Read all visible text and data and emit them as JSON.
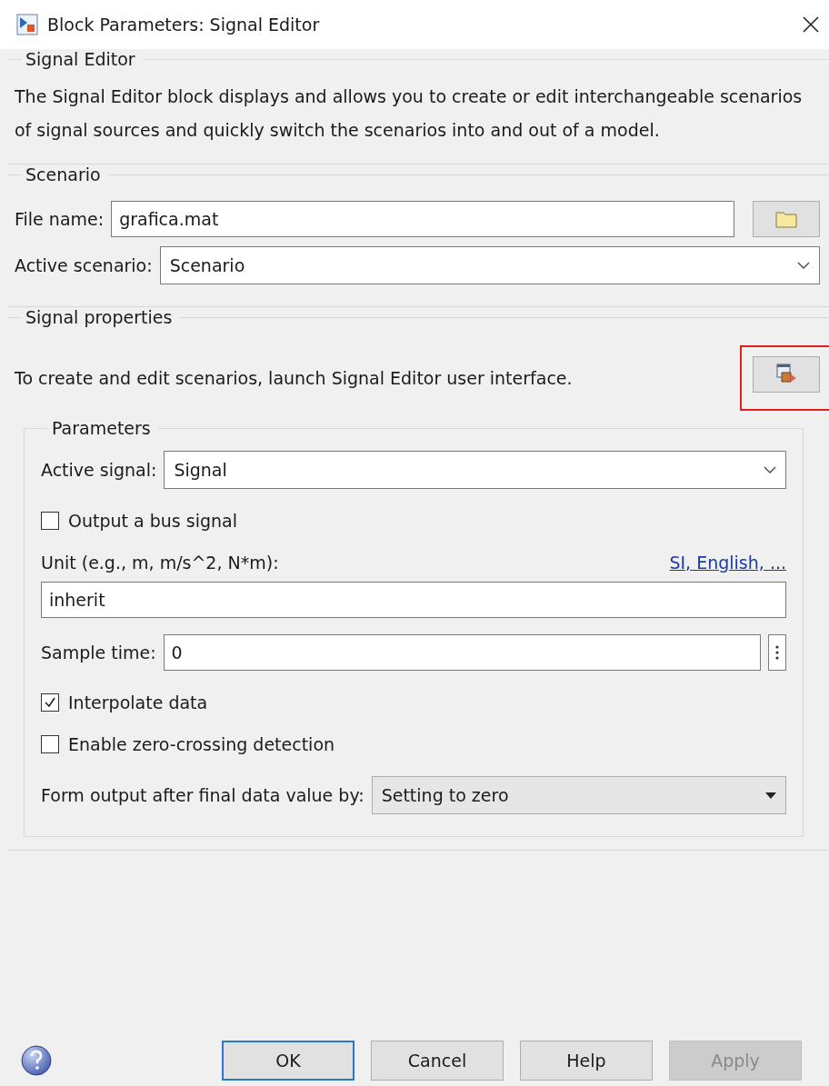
{
  "window": {
    "title": "Block Parameters: Signal Editor"
  },
  "description_group": {
    "title": "Signal Editor",
    "text": "The Signal Editor block displays and allows you to create or edit interchangeable scenarios of signal sources and quickly switch the scenarios into and out of a model."
  },
  "scenario_group": {
    "title": "Scenario",
    "file_name": {
      "label": "File name:",
      "value": "grafica.mat"
    },
    "active_scenario": {
      "label": "Active scenario:",
      "value": "Scenario"
    }
  },
  "signal_properties": {
    "title": "Signal properties",
    "launch_text": "To create and edit scenarios, launch Signal Editor user interface.",
    "launch_highlighted": true,
    "parameters": {
      "title": "Parameters",
      "active_signal": {
        "label": "Active signal:",
        "value": "Signal"
      },
      "output_bus": {
        "label": "Output a bus signal",
        "checked": false
      },
      "unit": {
        "label": "Unit (e.g., m, m/s^2, N*m):",
        "link": "SI, English, ...",
        "value": "inherit"
      },
      "sample_time": {
        "label": "Sample time:",
        "value": "0"
      },
      "options": [
        {
          "label": "Interpolate data",
          "checked": true
        },
        {
          "label": "Enable zero-crossing detection",
          "checked": false
        }
      ],
      "form_output": {
        "label": "Form output after final data value by:",
        "value": "Setting to zero"
      }
    }
  },
  "buttons": [
    {
      "label": "OK",
      "default": true,
      "disabled": false
    },
    {
      "label": "Cancel",
      "default": false,
      "disabled": false
    },
    {
      "label": "Help",
      "default": false,
      "disabled": false
    },
    {
      "label": "Apply",
      "default": false,
      "disabled": true
    }
  ]
}
